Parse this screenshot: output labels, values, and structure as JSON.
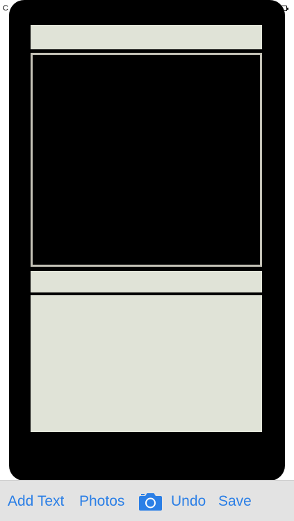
{
  "status_bar": {
    "left_text": "C"
  },
  "card": {
    "title_value": "",
    "type_value": "",
    "text_value": ""
  },
  "toolbar": {
    "add_text_label": "Add Text",
    "photos_label": "Photos",
    "camera_icon": "camera-icon",
    "undo_label": "Undo",
    "save_label": "Save"
  },
  "colors": {
    "card_background": "#000000",
    "field_background": "#e0e3d7",
    "frame_border": "#c4c2b7",
    "toolbar_background": "#e3e3e3",
    "accent": "#2b7fe6"
  }
}
